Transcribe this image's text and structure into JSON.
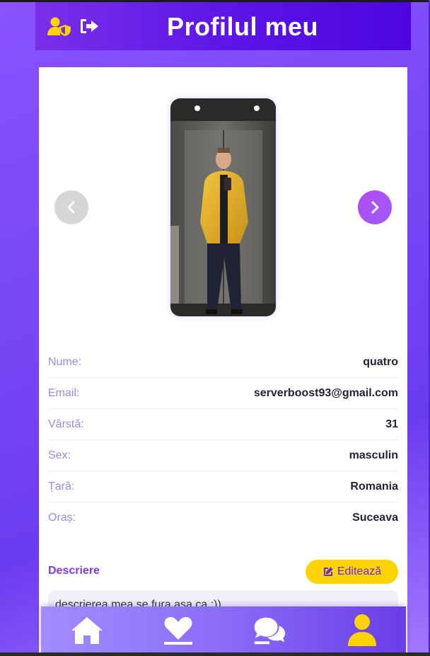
{
  "header": {
    "title": "Profilul meu",
    "user_shield_icon": "user-shield-icon",
    "logout_icon": "sign-out-icon"
  },
  "carousel": {
    "prev_icon": "chevron-left-icon",
    "next_icon": "chevron-right-icon",
    "photo_alt": "profile photo"
  },
  "profile": {
    "rows": [
      {
        "label": "Nume:",
        "value": "quatro"
      },
      {
        "label": "Email:",
        "value": "serverboost93@gmail.com"
      },
      {
        "label": "Vârstă:",
        "value": "31"
      },
      {
        "label": "Sex:",
        "value": "masculin"
      },
      {
        "label": "Țară:",
        "value": "Romania"
      },
      {
        "label": "Oraș:",
        "value": "Suceava"
      }
    ]
  },
  "description": {
    "title": "Descriere",
    "edit_label": "Editează",
    "text": "descrierea mea se fura asa ca :))"
  },
  "nav": {
    "items": [
      "home-icon",
      "heart-icon",
      "chat-icon",
      "user-icon"
    ],
    "active": "user-icon"
  },
  "colors": {
    "accent": "#7c3aed",
    "yellow": "#ffd300",
    "header_start": "#7a2fe8",
    "header_end": "#4d06e0"
  }
}
